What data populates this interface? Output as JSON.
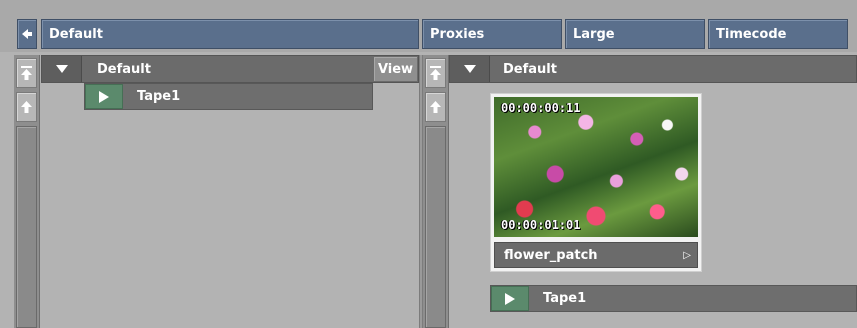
{
  "toolbar": {
    "left_panel_label": "Default",
    "buttons": [
      "Proxies",
      "Large",
      "Timecode"
    ]
  },
  "left_panel": {
    "header_label": "Default",
    "view_label": "View",
    "rows": [
      {
        "label": "Tape1"
      }
    ]
  },
  "right_panel": {
    "header_label": "Default",
    "clip": {
      "tc_in": "00:00:00:11",
      "tc_out": "00:00:01:01",
      "name": "flower_patch"
    },
    "rows": [
      {
        "label": "Tape1"
      }
    ]
  },
  "colors": {
    "toolbar_button": "#5a6f8c",
    "play_green": "#5b8a6c",
    "header_gray": "#6b6b6b",
    "background": "#b3b3b3"
  }
}
